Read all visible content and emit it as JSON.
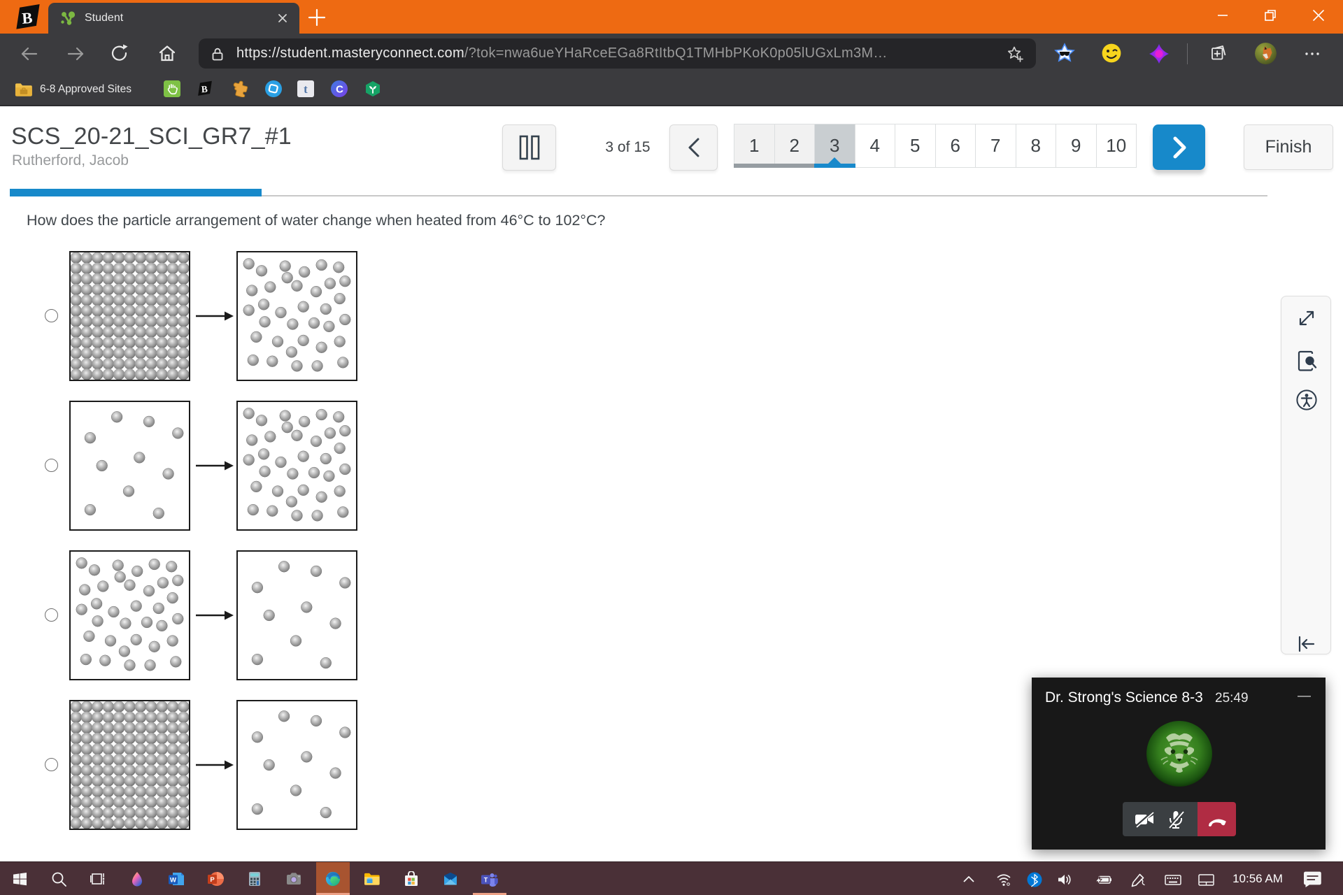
{
  "colors": {
    "titlebar_orange": "#ee6a12",
    "chrome_dark": "#3b3b3e",
    "addressbar_dark": "#252528",
    "accent_blue": "#1789ca",
    "pagination_current": "#c9ced1",
    "teams_red": "#b02c43",
    "taskbar_maroon": "#4a3037",
    "taskbar_highlight": "#a85430"
  },
  "browser": {
    "pinned_tab": {
      "icon": "brainpop-icon"
    },
    "active_tab": {
      "favicon": "student-molecule-icon",
      "title": "Student",
      "close_icon": "close-icon"
    },
    "newtab_icon": "plus-icon",
    "window_controls": [
      "minimize-icon",
      "restore-icon",
      "close-icon"
    ],
    "toolbar": {
      "nav_icons": [
        "back-icon",
        "forward-icon",
        "reload-icon",
        "home-icon"
      ],
      "address": {
        "lock_icon": "lock-icon",
        "url_main": "https://student.masteryconnect.com",
        "url_token": "/?tok=nwa6ueYHaRceEGa8RtItbQ1TMHbPKoK0p05lUGxLm3M…",
        "favorite_icon": "star-add-icon"
      },
      "extensions": [
        "star-sunglasses-icon",
        "smiley-icon",
        "purple-blob-icon"
      ],
      "collections_icon": "collections-icon",
      "profile_avatar": "fox-avatar",
      "more_icon": "ellipsis-icon"
    },
    "bookmarks": {
      "folder_icon": "folder-icon",
      "folder_label": "6-8 Approved Sites",
      "favicons": [
        "hand-tile-icon",
        "brainpop-icon",
        "puzzle-icon",
        "blue-ring-icon",
        "t-tile-icon",
        "clever-c-icon",
        "hex-sprout-icon"
      ]
    }
  },
  "test": {
    "title": "SCS_20-21_SCI_GR7_#1",
    "student": "Rutherford, Jacob",
    "pause_icon": "pause-icon",
    "position": "3 of 15",
    "prev_icon": "chevron-left-icon",
    "pages": [
      "1",
      "2",
      "3",
      "4",
      "5",
      "6",
      "7",
      "8",
      "9",
      "10"
    ],
    "current_page": "3",
    "visited_pages": [
      "1",
      "2"
    ],
    "next_icon": "chevron-right-icon",
    "finish_label": "Finish",
    "progress_percent": 20,
    "question": "How does the particle arrangement of water change when heated from 46°C to 102°C?",
    "options": [
      {
        "from": "solid",
        "to": "dense"
      },
      {
        "from": "sparse",
        "to": "dense"
      },
      {
        "from": "dense",
        "to": "sparse"
      },
      {
        "from": "solid",
        "to": "sparse"
      }
    ],
    "patterns": {
      "solid": {
        "cols": 11,
        "rows": 12
      },
      "dense": [
        [
          0.05,
          0.05
        ],
        [
          0.17,
          0.11
        ],
        [
          0.39,
          0.07
        ],
        [
          0.57,
          0.12
        ],
        [
          0.73,
          0.06
        ],
        [
          0.89,
          0.08
        ],
        [
          0.08,
          0.28
        ],
        [
          0.25,
          0.25
        ],
        [
          0.41,
          0.17
        ],
        [
          0.5,
          0.24
        ],
        [
          0.68,
          0.29
        ],
        [
          0.81,
          0.22
        ],
        [
          0.95,
          0.2
        ],
        [
          0.05,
          0.45
        ],
        [
          0.19,
          0.4
        ],
        [
          0.35,
          0.47
        ],
        [
          0.56,
          0.42
        ],
        [
          0.77,
          0.44
        ],
        [
          0.9,
          0.35
        ],
        [
          0.2,
          0.55
        ],
        [
          0.46,
          0.57
        ],
        [
          0.66,
          0.56
        ],
        [
          0.8,
          0.59
        ],
        [
          0.95,
          0.53
        ],
        [
          0.12,
          0.68
        ],
        [
          0.32,
          0.72
        ],
        [
          0.56,
          0.71
        ],
        [
          0.73,
          0.77
        ],
        [
          0.9,
          0.72
        ],
        [
          0.09,
          0.88
        ],
        [
          0.27,
          0.89
        ],
        [
          0.45,
          0.81
        ],
        [
          0.5,
          0.93
        ],
        [
          0.69,
          0.93
        ],
        [
          0.93,
          0.9
        ]
      ],
      "sparse": [
        [
          0.38,
          0.08
        ],
        [
          0.68,
          0.12
        ],
        [
          0.95,
          0.22
        ],
        [
          0.13,
          0.26
        ],
        [
          0.59,
          0.43
        ],
        [
          0.24,
          0.5
        ],
        [
          0.86,
          0.57
        ],
        [
          0.49,
          0.72
        ],
        [
          0.13,
          0.88
        ],
        [
          0.77,
          0.91
        ]
      ]
    }
  },
  "side_panel": {
    "icons": [
      "expand-icon",
      "review-zoom-icon",
      "accessibility-icon"
    ],
    "collapse_icon": "collapse-left-icon"
  },
  "teams": {
    "title": "Dr. Strong's Science 8-3",
    "timer": "25:49",
    "minimize_label": "—",
    "avatar": "tiger-avatar",
    "controls": [
      "camera-off-icon",
      "mic-off-icon"
    ],
    "hangup_icon": "hangup-icon"
  },
  "taskbar": {
    "apps": [
      {
        "icon": "start-icon"
      },
      {
        "icon": "search-icon"
      },
      {
        "icon": "taskview-icon"
      },
      {
        "icon": "paint3d-icon"
      },
      {
        "icon": "word-icon"
      },
      {
        "icon": "powerpoint-icon"
      },
      {
        "icon": "calculator-icon"
      },
      {
        "icon": "camera-app-icon"
      },
      {
        "icon": "edge-icon",
        "active": true,
        "underline": true
      },
      {
        "icon": "explorer-icon"
      },
      {
        "icon": "store-icon"
      },
      {
        "icon": "mail-icon"
      },
      {
        "icon": "teams-icon",
        "underline": true
      }
    ],
    "tray_icons": [
      "chevron-up-icon",
      "wifi-icon",
      "bluetooth-icon",
      "volume-icon",
      "battery-icon",
      "pen-icon",
      "keyboard-icon",
      "touchpad-icon"
    ],
    "clock": "10:56 AM",
    "notification_icon": "notification-icon"
  }
}
